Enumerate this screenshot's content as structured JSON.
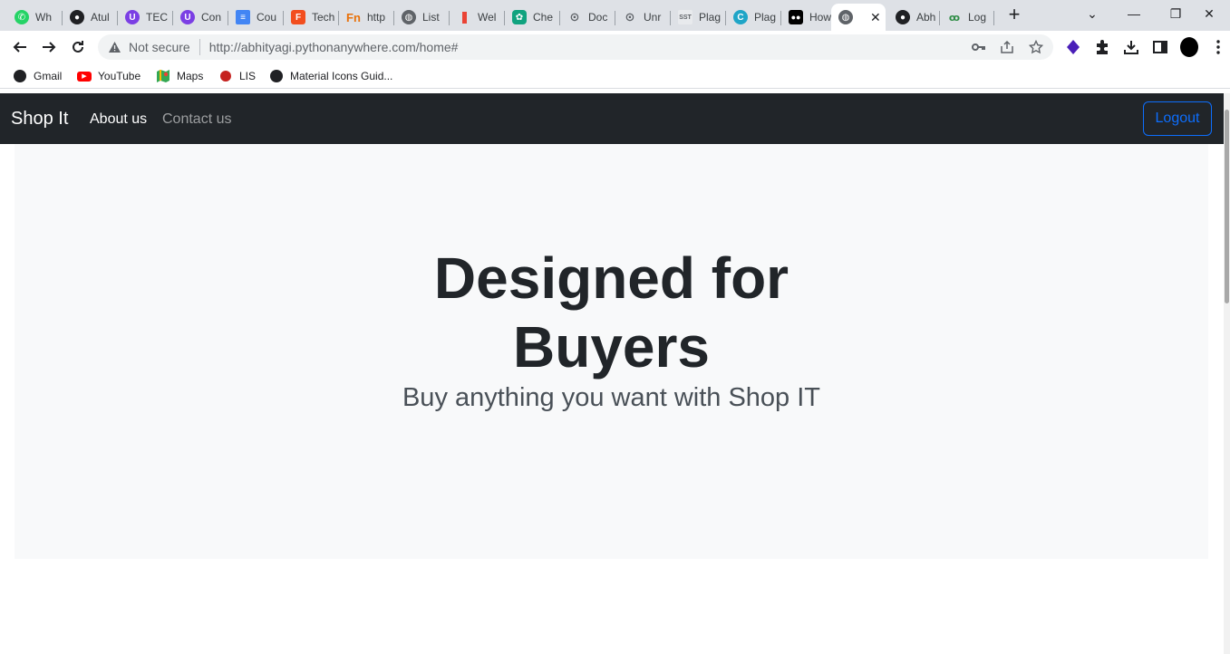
{
  "browser": {
    "tabs": [
      {
        "label": "Wh",
        "icon": "whatsapp-icon",
        "color": "#25d366"
      },
      {
        "label": "Atul",
        "icon": "github-icon",
        "color": "#202124"
      },
      {
        "label": "TEC",
        "icon": "u-icon",
        "color": "#7b3fe4"
      },
      {
        "label": "Con",
        "icon": "u-icon",
        "color": "#7b3fe4"
      },
      {
        "label": "Cou",
        "icon": "google-docs-icon",
        "color": "#4285f4"
      },
      {
        "label": "Tech",
        "icon": "figma-icon",
        "color": "#f24e1e"
      },
      {
        "label": "http",
        "icon": "fn-icon",
        "color": "#e8710a"
      },
      {
        "label": "List",
        "icon": "globe-icon",
        "color": "#5f6368"
      },
      {
        "label": "Wel",
        "icon": "bookmark-red-icon",
        "color": "#ea4335"
      },
      {
        "label": "Che",
        "icon": "openai-icon",
        "color": "#10a37f"
      },
      {
        "label": "Doc",
        "icon": "search-icon",
        "color": "#5f6368"
      },
      {
        "label": "Unr",
        "icon": "search-icon",
        "color": "#5f6368"
      },
      {
        "label": "Plag",
        "icon": "sst-icon",
        "color": "#9aa0a6"
      },
      {
        "label": "Plag",
        "icon": "c-icon",
        "color": "#1fa5c7"
      },
      {
        "label": "How",
        "icon": "medium-icon",
        "color": "#000000"
      },
      {
        "label": "",
        "icon": "globe-icon",
        "color": "#5f6368",
        "active": true
      },
      {
        "label": "Abh",
        "icon": "github-icon",
        "color": "#202124"
      },
      {
        "label": "Log",
        "icon": "gfg-icon",
        "color": "#2f8d46"
      }
    ],
    "address": {
      "security_label": "Not secure",
      "url": "http://abhityagi.pythonanywhere.com/home#"
    },
    "bookmarks": [
      {
        "label": "Gmail",
        "icon": "globe-icon"
      },
      {
        "label": "YouTube",
        "icon": "youtube-icon"
      },
      {
        "label": "Maps",
        "icon": "maps-icon"
      },
      {
        "label": "LIS",
        "icon": "lis-icon"
      },
      {
        "label": "Material Icons Guid...",
        "icon": "globe-icon"
      }
    ]
  },
  "page": {
    "navbar": {
      "brand": "Shop It",
      "links": [
        "About us",
        "Contact us"
      ],
      "logout_label": "Logout"
    },
    "hero": {
      "title_line1": "Designed for",
      "title_line2": "Buyers",
      "subtitle": "Buy anything you want with Shop IT"
    }
  },
  "colors": {
    "navbar_bg": "#212529",
    "hero_bg": "#f8f9fa",
    "primary": "#0d6efd",
    "text_dark": "#212529",
    "text_muted": "#495057"
  }
}
